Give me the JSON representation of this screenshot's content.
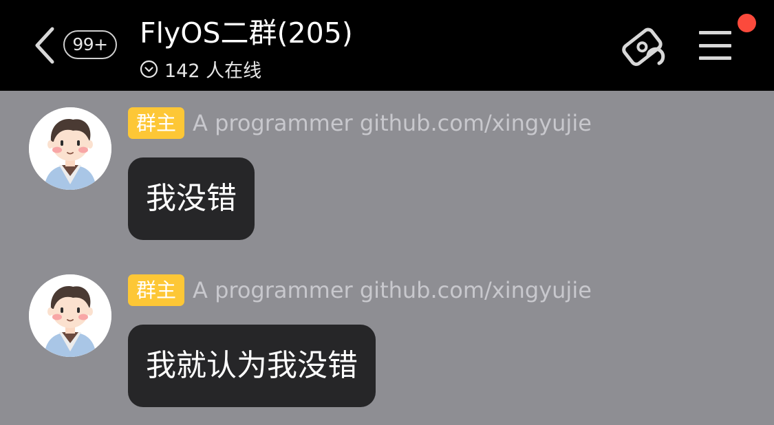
{
  "header": {
    "back_icon": "chevron-left-icon",
    "unread_badge": "99+",
    "title": "FlyOS二群(205)",
    "online_icon": "chevron-down-circle-icon",
    "online_text": "142 人在线",
    "ticket_icon": "ticket-link-icon",
    "menu_icon": "hamburger-menu-icon",
    "notification_dot_color": "#fb4a3c"
  },
  "colors": {
    "header_bg": "#000000",
    "chat_bg": "#8e8e93",
    "bubble_bg": "#262628",
    "role_badge_bg": "#fdc736"
  },
  "messages": [
    {
      "avatar": "cartoon-boy-avatar",
      "role": "群主",
      "sender": "A programmer github.com/xingyujie",
      "text": "我没错"
    },
    {
      "avatar": "cartoon-boy-avatar",
      "role": "群主",
      "sender": "A programmer github.com/xingyujie",
      "text": "我就认为我没错"
    }
  ]
}
